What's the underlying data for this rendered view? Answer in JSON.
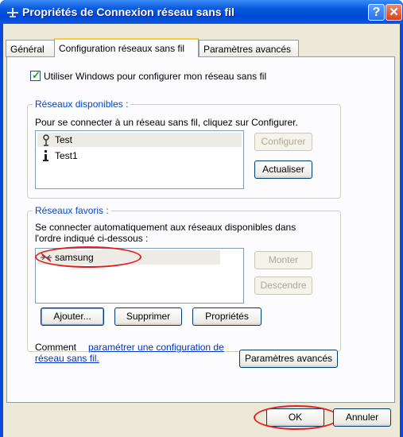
{
  "window": {
    "title": "Propriétés de Connexion réseau sans fil",
    "help_label": "?",
    "close_label": "✕"
  },
  "tabs": [
    {
      "label": "Général"
    },
    {
      "label": "Configuration réseaux sans fil"
    },
    {
      "label": "Paramètres avancés"
    }
  ],
  "wireless": {
    "use_windows_label": "Utiliser Windows pour configurer mon réseau sans fil",
    "use_windows_checked": true
  },
  "available": {
    "title": "Réseaux disponibles :",
    "description": "Pour se connecter à un réseau sans fil, cliquez sur Configurer.",
    "networks": [
      {
        "name": "Test",
        "icon": "wireless-antenna-icon"
      },
      {
        "name": "Test1",
        "icon": "info-icon"
      }
    ],
    "configure_label": "Configurer",
    "refresh_label": "Actualiser"
  },
  "preferred": {
    "title": "Réseaux favoris :",
    "description_line1": "Se connecter automatiquement aux réseaux disponibles dans",
    "description_line2": "l'ordre indiqué ci-dessous :",
    "networks": [
      {
        "name": "samsung",
        "icon": "wireless-unavailable-icon"
      }
    ],
    "up_label": "Monter",
    "down_label": "Descendre",
    "add_label": "Ajouter...",
    "remove_label": "Supprimer",
    "properties_label": "Propriétés"
  },
  "footer": {
    "help_prefix": "Comment ",
    "help_link_line1": "paramétrer une configuration de",
    "help_link_line2": "réseau sans fil.",
    "advanced_label": "Paramètres avancés"
  },
  "dialog": {
    "ok_label": "OK",
    "cancel_label": "Annuler"
  },
  "colors": {
    "title_bar": "#0a5ae0",
    "dialog_bg": "#ece9d8",
    "highlight_circle": "#e02020",
    "group_title": "#0046d5"
  }
}
